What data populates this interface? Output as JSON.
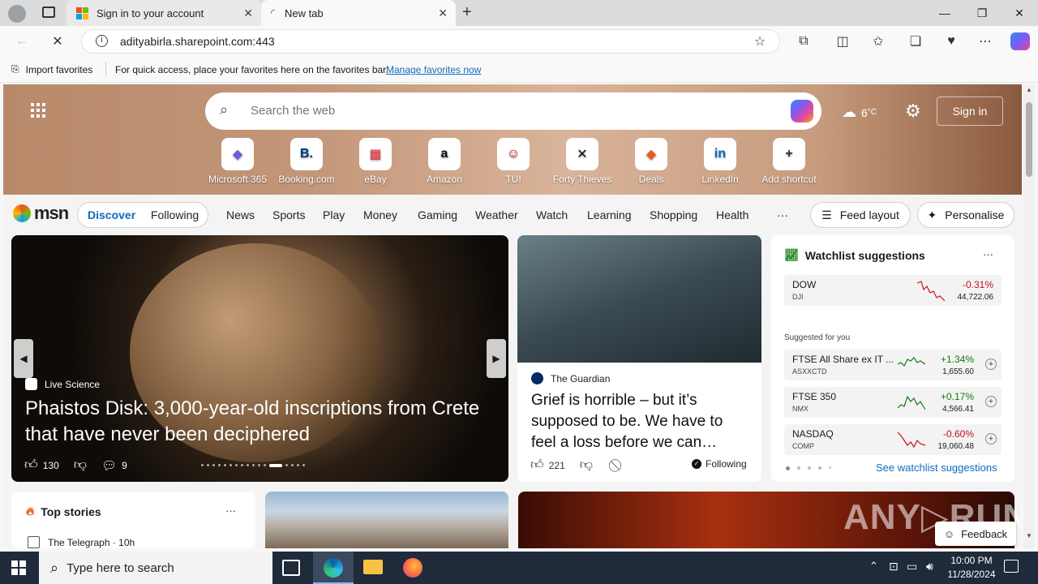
{
  "browser": {
    "tabs": [
      {
        "label": "Sign in to your account"
      },
      {
        "label": "New tab"
      }
    ],
    "address": "adityabirla.sharepoint.com:443",
    "favorites_bar": {
      "import_label": "Import favorites",
      "hint": "For quick access, place your favorites here on the favorites bar.",
      "manage_link": "Manage favorites now"
    }
  },
  "msn": {
    "search_placeholder": "Search the web",
    "weather": "6",
    "weather_unit": "°C",
    "sign_in": "Sign in",
    "shortcuts": [
      {
        "label": "Microsoft 365",
        "glyph": "◆",
        "color": "#6f5bd8"
      },
      {
        "label": "Booking.com",
        "glyph": "B.",
        "color": "#003580"
      },
      {
        "label": "eBay",
        "glyph": "▦",
        "color": "#e53238"
      },
      {
        "label": "Amazon",
        "glyph": "a",
        "color": "#111111"
      },
      {
        "label": "TUI",
        "glyph": "☺",
        "color": "#d40e14"
      },
      {
        "label": "Forty Thieves",
        "glyph": "✕",
        "color": "#111111"
      },
      {
        "label": "Deals",
        "glyph": "◆",
        "color": "#e8591a"
      },
      {
        "label": "LinkedIn",
        "glyph": "in",
        "color": "#0a66c2"
      },
      {
        "label": "Add shortcut",
        "glyph": "+",
        "color": "#333333"
      }
    ],
    "logo": "msn",
    "nav_pills": [
      "Discover",
      "Following"
    ],
    "nav": [
      "News",
      "Sports",
      "Play",
      "Money",
      "Gaming",
      "Weather",
      "Watch",
      "Learning",
      "Shopping",
      "Health"
    ],
    "more": "···",
    "feed_layout": "Feed layout",
    "personalise": "Personalise",
    "hero": {
      "source": "Live Science",
      "title": "Phaistos Disk: 3,000-year-old inscriptions from Crete that have never been deciphered",
      "likes": "130",
      "comments": "9"
    },
    "guardian": {
      "source": "The Guardian",
      "title": "Grief is horrible – but it’s supposed to be. We have to feel a loss before we can…",
      "likes": "221",
      "following": "Following"
    },
    "watchlist": {
      "title": "Watchlist suggestions",
      "main": {
        "name": "DOW",
        "ticker": "DJI",
        "change": "-0.31%",
        "price": "44,722.06"
      },
      "suggested_label": "Suggested for you",
      "items": [
        {
          "name": "FTSE All Share ex IT ...",
          "ticker": "ASXXCTD",
          "change": "+1.34%",
          "price": "1,655.60",
          "up": true
        },
        {
          "name": "FTSE 350",
          "ticker": "NMX",
          "change": "+0.17%",
          "price": "4,566.41",
          "up": true
        },
        {
          "name": "NASDAQ",
          "ticker": "COMP",
          "change": "-0.60%",
          "price": "19,060.48",
          "up": false
        }
      ],
      "see_more": "See watchlist suggestions"
    },
    "top_stories": {
      "title": "Top stories",
      "first_source": "The Telegraph · 10h"
    },
    "feedback": "Feedback"
  },
  "taskbar": {
    "search_placeholder": "Type here to search",
    "time": "10:00 PM",
    "date": "11/28/2024"
  },
  "colors": {
    "accent": "#0f6cbd",
    "up": "#107c10",
    "down": "#c50f1f"
  }
}
